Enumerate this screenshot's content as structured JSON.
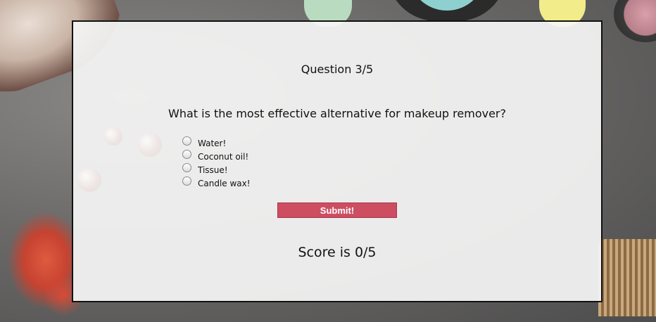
{
  "quiz": {
    "counter": "Question 3/5",
    "question": "What is the most effective alternative for makeup remover?",
    "options": [
      {
        "label": "Water!",
        "selected": false
      },
      {
        "label": "Coconut oil!",
        "selected": false
      },
      {
        "label": "Tissue!",
        "selected": false
      },
      {
        "label": "Candle wax!",
        "selected": false
      }
    ],
    "submit_label": "Submit!",
    "score": "Score is 0/5"
  },
  "colors": {
    "submit_button": "#cd4d61",
    "panel_background": "#f5f5f5",
    "panel_border": "#111111"
  }
}
